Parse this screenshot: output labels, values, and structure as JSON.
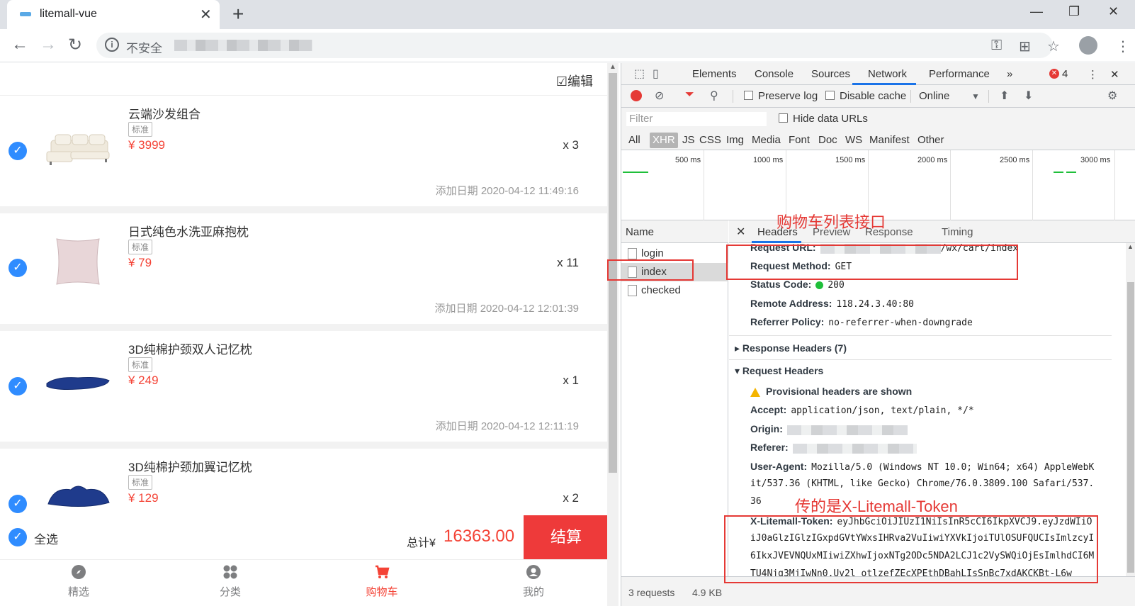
{
  "browser": {
    "tab_title": "litemall-vue",
    "insecure_label": "不安全",
    "window_controls": [
      "minimize-icon",
      "restore-icon",
      "close-icon"
    ]
  },
  "app": {
    "edit_label": "☑编辑",
    "items": [
      {
        "name": "云端沙发组合",
        "tag": "标准",
        "price": "¥ 3999",
        "qty": "x 3",
        "date": "添加日期 2020-04-12 11:49:16"
      },
      {
        "name": "日式纯色水洗亚麻抱枕",
        "tag": "标准",
        "price": "¥ 79",
        "qty": "x 11",
        "date": "添加日期 2020-04-12 12:01:39"
      },
      {
        "name": "3D纯棉护颈双人记忆枕",
        "tag": "标准",
        "price": "¥ 249",
        "qty": "x 1",
        "date": "添加日期 2020-04-12 12:11:19"
      },
      {
        "name": "3D纯棉护颈加翼记忆枕",
        "tag": "标准",
        "price": "¥ 129",
        "qty": "x 2",
        "date": ""
      }
    ],
    "select_all": "全选",
    "total_label": "总计¥",
    "total_value": "16363.00",
    "checkout": "结算",
    "tabbar": [
      {
        "label": "精选",
        "icon": "compass-icon",
        "active": false
      },
      {
        "label": "分类",
        "icon": "grid-icon",
        "active": false
      },
      {
        "label": "购物车",
        "icon": "cart-icon",
        "active": true
      },
      {
        "label": "我的",
        "icon": "user-icon",
        "active": false
      }
    ],
    "colors": {
      "accent": "#f44336",
      "checkbox": "#2f8cff",
      "checkout": "#ee3a3a"
    }
  },
  "devtools": {
    "tabs": [
      "Elements",
      "Console",
      "Sources",
      "Network",
      "Performance"
    ],
    "more_tabs": "»",
    "error_count": "4",
    "toolbar": {
      "preserve_log": "Preserve log",
      "disable_cache": "Disable cache",
      "throttle": "Online"
    },
    "filter_placeholder": "Filter",
    "hide_data_urls": "Hide data URLs",
    "types": [
      "All",
      "XHR",
      "JS",
      "CSS",
      "Img",
      "Media",
      "Font",
      "Doc",
      "WS",
      "Manifest",
      "Other"
    ],
    "timeline_labels": [
      "500 ms",
      "1000 ms",
      "1500 ms",
      "2000 ms",
      "2500 ms",
      "3000 ms"
    ],
    "name_header": "Name",
    "requests": [
      {
        "name": "login",
        "selected": false
      },
      {
        "name": "index",
        "selected": true
      },
      {
        "name": "checked",
        "selected": false
      }
    ],
    "status": {
      "requests": "3 requests",
      "size": "4.9 KB"
    },
    "header_tabs": [
      "Headers",
      "Preview",
      "Response",
      "Timing"
    ],
    "general": {
      "request_url_label": "Request URL:",
      "request_url_value": "/wx/cart/index",
      "request_method_label": "Request Method:",
      "request_method_value": "GET",
      "status_code_label": "Status Code:",
      "status_code_value": "200",
      "remote_address_label": "Remote Address:",
      "remote_address_value": "118.24.3.40:80",
      "referrer_policy_label": "Referrer Policy:",
      "referrer_policy_value": "no-referrer-when-downgrade"
    },
    "response_headers": "Response Headers (7)",
    "request_headers": "Request Headers",
    "provisional": "Provisional headers are shown",
    "req": {
      "accept_label": "Accept:",
      "accept_value": "application/json, text/plain, */*",
      "origin_label": "Origin:",
      "referer_label": "Referer:",
      "ua_label": "User-Agent:",
      "ua_line1": "Mozilla/5.0 (Windows NT 10.0; Win64; x64) AppleWebK",
      "ua_line2": "it/537.36 (KHTML, like Gecko) Chrome/76.0.3809.100 Safari/537.",
      "ua_line3": "36",
      "token_label": "X-Litemall-Token:",
      "token_line1": "eyJhbGciOiJIUzI1NiIsInR5cCI6IkpXVCJ9.eyJzdWIiO",
      "token_line2": "iJ0aGlzIGlzIGxpdGVtYWxsIHRva2VuIiwiYXVkIjoiTUlOSUFQUCIsImlzcyI",
      "token_line3": "6IkxJVEVNQUxMIiwiZXhwIjoxNTg2ODc5NDA2LCJ1c2VySWQiOjEsImlhdCI6M",
      "token_line4": "TU4Njg3MjIwNn0.Uv2l_otlzefZEcXPEthDBahLIsSnBc7xdAKCKBt-L6w"
    }
  },
  "annotations": {
    "cart_api": "购物车列表接口",
    "token_note": "传的是X-Litemall-Token"
  }
}
